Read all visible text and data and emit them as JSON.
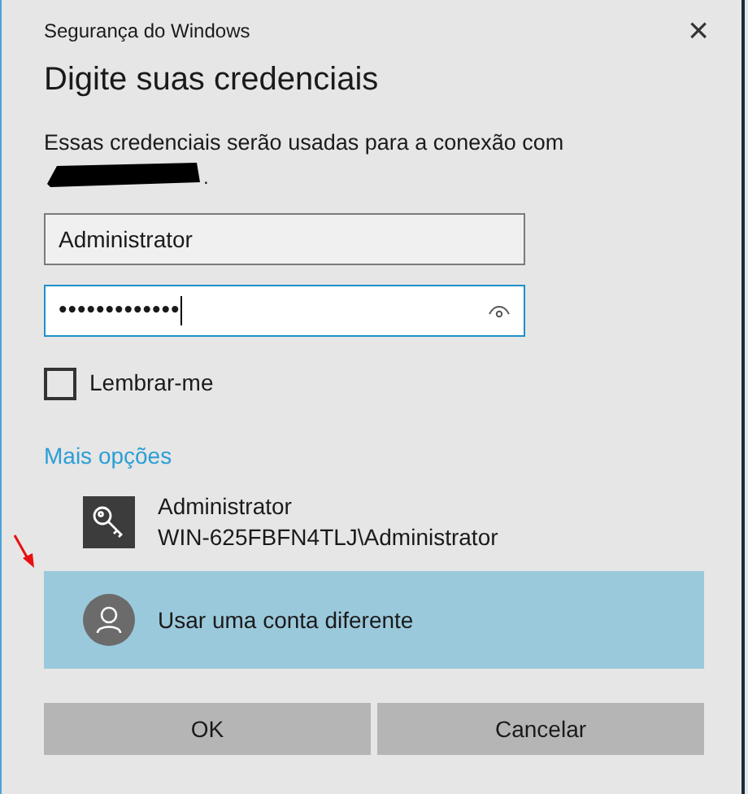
{
  "window": {
    "title": "Segurança do Windows",
    "close": "×"
  },
  "heading": "Digite suas credenciais",
  "description": "Essas credenciais serão usadas para a conexão com",
  "description_end": ".",
  "username": {
    "value": "Administrator"
  },
  "password": {
    "value": "•••••••••••••",
    "focused": true
  },
  "remember": {
    "label": "Lembrar-me",
    "checked": false
  },
  "more_options": "Mais opções",
  "accounts": [
    {
      "kind": "credential",
      "name": "Administrator",
      "detail": "WIN-625FBFN4TLJ\\Administrator",
      "selected": false
    },
    {
      "kind": "other",
      "name": "Usar uma conta diferente",
      "selected": true
    }
  ],
  "buttons": [
    "OK",
    "Cancelar"
  ]
}
